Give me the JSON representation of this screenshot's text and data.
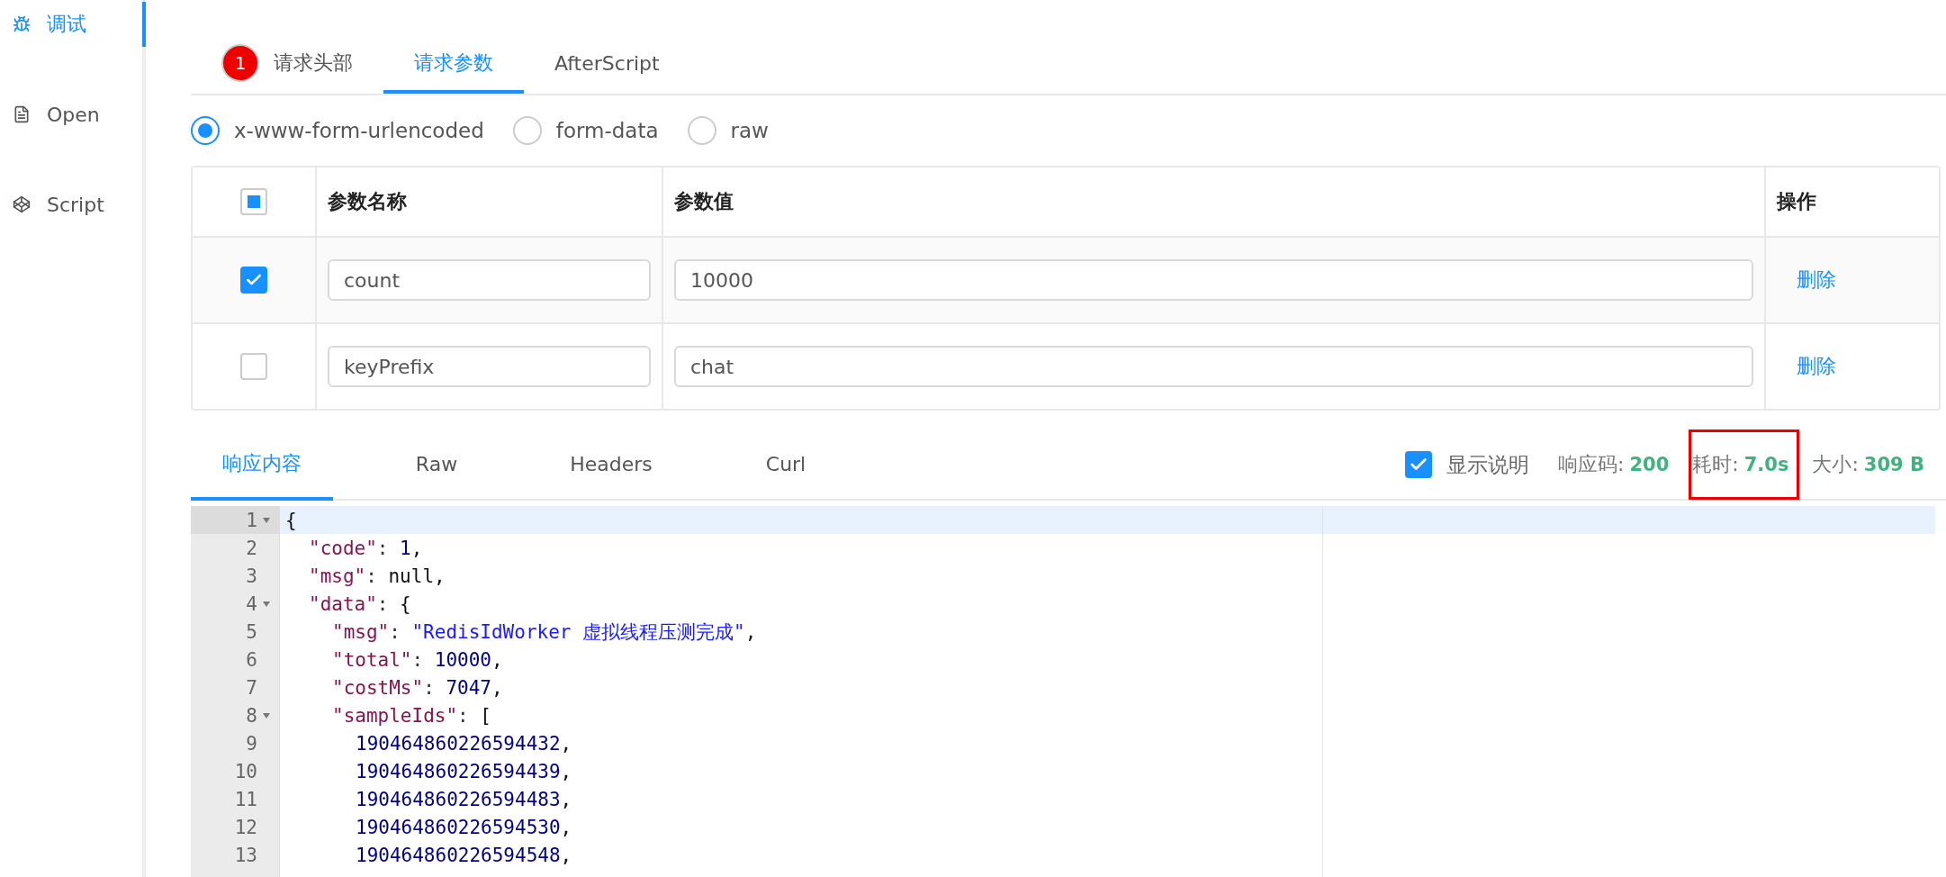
{
  "sidebar": {
    "items": [
      {
        "label": "调试",
        "selected": true
      },
      {
        "label": "Open",
        "selected": false
      },
      {
        "label": "Script",
        "selected": false
      }
    ]
  },
  "request_tabs": [
    {
      "label": "请求头部",
      "badge": "1",
      "selected": false
    },
    {
      "label": "请求参数",
      "selected": true
    },
    {
      "label": "AfterScript",
      "selected": false
    }
  ],
  "body_types": [
    {
      "label": "x-www-form-urlencoded",
      "selected": true
    },
    {
      "label": "form-data",
      "selected": false
    },
    {
      "label": "raw",
      "selected": false
    }
  ],
  "params_table": {
    "select_all_indeterminate": true,
    "columns": [
      "参数名称",
      "参数值",
      "操作"
    ],
    "rows": [
      {
        "checked": true,
        "name": "count",
        "value": "10000",
        "action": "删除"
      },
      {
        "checked": false,
        "name": "keyPrefix",
        "value": "chat",
        "action": "删除"
      }
    ]
  },
  "response_tabs": [
    {
      "label": "响应内容",
      "selected": true
    },
    {
      "label": "Raw",
      "selected": false
    },
    {
      "label": "Headers",
      "selected": false
    },
    {
      "label": "Curl",
      "selected": false
    }
  ],
  "show_description": {
    "label": "显示说明",
    "checked": true
  },
  "stats": [
    {
      "label": "响应码:",
      "value": "200",
      "highlighted": false
    },
    {
      "label": "耗时:",
      "value": "7.0s",
      "highlighted": true
    },
    {
      "label": "大小:",
      "value": "309 B",
      "highlighted": false
    }
  ],
  "code_editor": {
    "lines": [
      {
        "number": "1",
        "current": true,
        "tokens": [
          {
            "kind": "punct",
            "text": "{"
          }
        ],
        "children": [
          {
            "number": "2",
            "current": false,
            "tokens": [
              {
                "kind": "key",
                "text": "\"code\""
              },
              {
                "kind": "colon",
                "text": ":"
              },
              {
                "kind": "number",
                "text": "1"
              },
              {
                "kind": "punct",
                "text": ","
              }
            ]
          },
          {
            "number": "3",
            "current": false,
            "tokens": [
              {
                "kind": "key",
                "text": "\"msg\""
              },
              {
                "kind": "colon",
                "text": ":"
              },
              {
                "kind": "punct",
                "text": "null,"
              }
            ]
          },
          {
            "number": "4",
            "current": false,
            "tokens": [
              {
                "kind": "key",
                "text": "\"data\""
              },
              {
                "kind": "colon",
                "text": ":"
              },
              {
                "kind": "punct",
                "text": "{"
              }
            ],
            "children": [
              {
                "number": "5",
                "current": false,
                "tokens": [
                  {
                    "kind": "key",
                    "text": "\"msg\""
                  },
                  {
                    "kind": "colon",
                    "text": ":"
                  },
                  {
                    "kind": "string",
                    "text": "\"RedisIdWorker 虚拟线程压测完成\""
                  },
                  {
                    "kind": "punct",
                    "text": ","
                  }
                ]
              },
              {
                "number": "6",
                "current": false,
                "tokens": [
                  {
                    "kind": "key",
                    "text": "\"total\""
                  },
                  {
                    "kind": "colon",
                    "text": ":"
                  },
                  {
                    "kind": "number",
                    "text": "10000"
                  },
                  {
                    "kind": "punct",
                    "text": ","
                  }
                ]
              },
              {
                "number": "7",
                "current": false,
                "tokens": [
                  {
                    "kind": "key",
                    "text": "\"costMs\""
                  },
                  {
                    "kind": "colon",
                    "text": ":"
                  },
                  {
                    "kind": "number",
                    "text": "7047"
                  },
                  {
                    "kind": "punct",
                    "text": ","
                  }
                ]
              },
              {
                "number": "8",
                "current": false,
                "tokens": [
                  {
                    "kind": "key",
                    "text": "\"sampleIds\""
                  },
                  {
                    "kind": "colon",
                    "text": ":"
                  },
                  {
                    "kind": "punct",
                    "text": "["
                  }
                ],
                "children": [
                  {
                    "number": "9",
                    "current": false,
                    "tokens": [
                      {
                        "kind": "number",
                        "text": "190464860226594432"
                      },
                      {
                        "kind": "punct",
                        "text": ","
                      }
                    ]
                  },
                  {
                    "number": "10",
                    "current": false,
                    "tokens": [
                      {
                        "kind": "number",
                        "text": "190464860226594439"
                      },
                      {
                        "kind": "punct",
                        "text": ","
                      }
                    ]
                  },
                  {
                    "number": "11",
                    "current": false,
                    "tokens": [
                      {
                        "kind": "number",
                        "text": "190464860226594483"
                      },
                      {
                        "kind": "punct",
                        "text": ","
                      }
                    ]
                  },
                  {
                    "number": "12",
                    "current": false,
                    "tokens": [
                      {
                        "kind": "number",
                        "text": "190464860226594530"
                      },
                      {
                        "kind": "punct",
                        "text": ","
                      }
                    ]
                  },
                  {
                    "number": "13",
                    "current": false,
                    "tokens": [
                      {
                        "kind": "number",
                        "text": "190464860226594548"
                      },
                      {
                        "kind": "punct",
                        "text": ","
                      }
                    ]
                  }
                ]
              }
            ]
          }
        ]
      }
    ]
  }
}
